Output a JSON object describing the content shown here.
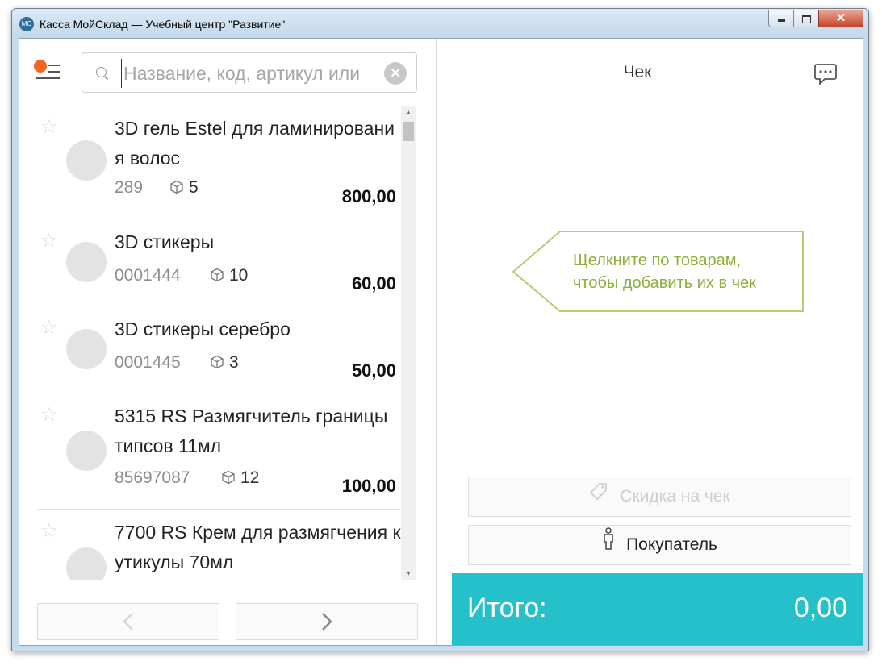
{
  "window": {
    "icon_text": "МС",
    "title": "Касса МойСклад — Учебный центр \"Развитие\"",
    "close_glyph": "✕"
  },
  "search": {
    "placeholder": "Название, код, артикул или",
    "value": "",
    "clear_glyph": "×"
  },
  "icons": {
    "star": "☆",
    "scroll_up": "▲",
    "scroll_down": "▼"
  },
  "products": [
    {
      "name": "3D гель Estel для ламинирования волос",
      "code": "289",
      "stock": "5",
      "price": "800,00"
    },
    {
      "name": "3D стикеры",
      "code": "0001444",
      "stock": "10",
      "price": "60,00"
    },
    {
      "name": "3D стикеры серебро",
      "code": "0001445",
      "stock": "3",
      "price": "50,00"
    },
    {
      "name": "5315 RS Размягчитель границы типсов 11мл",
      "code": "85697087",
      "stock": "12",
      "price": "100,00"
    },
    {
      "name": "7700 RS Крем для размягчения кутикулы 70мл",
      "code": "",
      "stock": "",
      "price": ""
    }
  ],
  "receipt": {
    "title": "Чек",
    "hint": "Щелкните по товарам, чтобы добавить их в чек",
    "hint_line1": "Щелкните по товарам,",
    "hint_line2": "чтобы добавить их в чек",
    "discount_label": "Скидка на чек",
    "buyer_label": "Покупатель",
    "total_label": "Итого:",
    "total_value": "0,00"
  },
  "colors": {
    "accent": "#25c0c9",
    "logo_orange": "#f26522",
    "hint_green": "#8dae3a"
  }
}
